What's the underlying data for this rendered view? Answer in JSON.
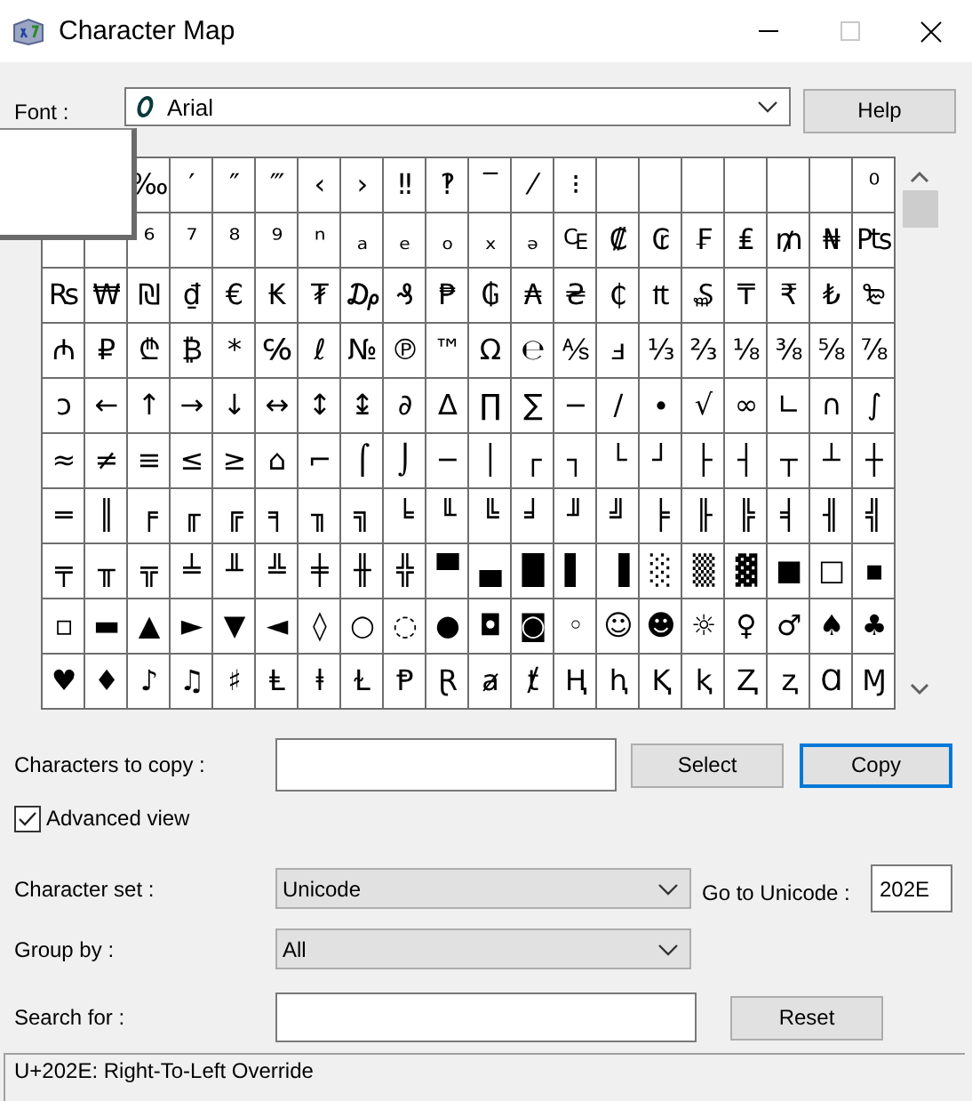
{
  "window": {
    "title": "Character Map"
  },
  "font": {
    "label": "Font :",
    "value": "Arial"
  },
  "help_button": "Help",
  "grid": {
    "rows": [
      [
        null,
        null,
        "‰",
        "′",
        "″",
        "‴",
        "‹",
        "›",
        "‼",
        "‽",
        "‾",
        "⁄",
        "⁝",
        null,
        null,
        null,
        null,
        null,
        null,
        "⁰"
      ],
      [
        null,
        null,
        "⁶",
        "⁷",
        "⁸",
        "⁹",
        "ⁿ",
        "ₐ",
        "ₑ",
        "ₒ",
        "ₓ",
        "ₔ",
        "₠",
        "₡",
        "₢",
        "₣",
        "₤",
        "₥",
        "₦",
        "₧"
      ],
      [
        "₨",
        "₩",
        "₪",
        "₫",
        "€",
        "₭",
        "₮",
        "₯",
        "₰",
        "₱",
        "₲",
        "₳",
        "₴",
        "₵",
        "₶",
        "₷",
        "₸",
        "₹",
        "₺",
        "₻"
      ],
      [
        "₼",
        "₽",
        "₾",
        "₿",
        "*",
        "℅",
        "ℓ",
        "№",
        "℗",
        "™",
        "Ω",
        "℮",
        "⅍",
        "ⅎ",
        "⅓",
        "⅔",
        "⅛",
        "⅜",
        "⅝",
        "⅞"
      ],
      [
        "ↄ",
        "←",
        "↑",
        "→",
        "↓",
        "↔",
        "↕",
        "↨",
        "∂",
        "∆",
        "∏",
        "∑",
        "−",
        "∕",
        "∙",
        "√",
        "∞",
        "∟",
        "∩",
        "∫"
      ],
      [
        "≈",
        "≠",
        "≡",
        "≤",
        "≥",
        "⌂",
        "⌐",
        "⌠",
        "⌡",
        "─",
        "│",
        "┌",
        "┐",
        "└",
        "┘",
        "├",
        "┤",
        "┬",
        "┴",
        "┼"
      ],
      [
        "═",
        "║",
        "╒",
        "╓",
        "╔",
        "╕",
        "╖",
        "╗",
        "╘",
        "╙",
        "╚",
        "╛",
        "╜",
        "╝",
        "╞",
        "╟",
        "╠",
        "╡",
        "╢",
        "╣"
      ],
      [
        "╤",
        "╥",
        "╦",
        "╧",
        "╨",
        "╩",
        "╪",
        "╫",
        "╬",
        "▀",
        "▄",
        "█",
        "▌",
        "▐",
        "░",
        "▒",
        "▓",
        "■",
        "□",
        "▪"
      ],
      [
        "▫",
        "▬",
        "▲",
        "►",
        "▼",
        "◄",
        "◊",
        "○",
        "◌",
        "●",
        "◘",
        "◙",
        "◦",
        "☺",
        "☻",
        "☼",
        "♀",
        "♂",
        "♠",
        "♣"
      ],
      [
        "♥",
        "♦",
        "♪",
        "♫",
        "♯",
        "Ⱡ",
        "ⱡ",
        "Ɫ",
        "Ᵽ",
        "Ɽ",
        "ⱥ",
        "ⱦ",
        "Ⱨ",
        "ⱨ",
        "Ⱪ",
        "ⱪ",
        "Ⱬ",
        "ⱬ",
        "Ɑ",
        "Ɱ"
      ]
    ]
  },
  "copy": {
    "label": "Characters to copy :",
    "buttons": [
      {
        "label": "Select",
        "focused": false
      },
      {
        "label": "Copy",
        "focused": true
      }
    ]
  },
  "advanced_view": {
    "label": "Advanced view",
    "checked": true
  },
  "character_set": {
    "label": "Character set :",
    "value": "Unicode"
  },
  "go_to_unicode": {
    "label": "Go to Unicode :",
    "value": "202E"
  },
  "group_by": {
    "label": "Group by :",
    "value": "All"
  },
  "search": {
    "label": "Search for :",
    "button": "Reset"
  },
  "status_bar": "U+202E: Right-To-Left Override"
}
